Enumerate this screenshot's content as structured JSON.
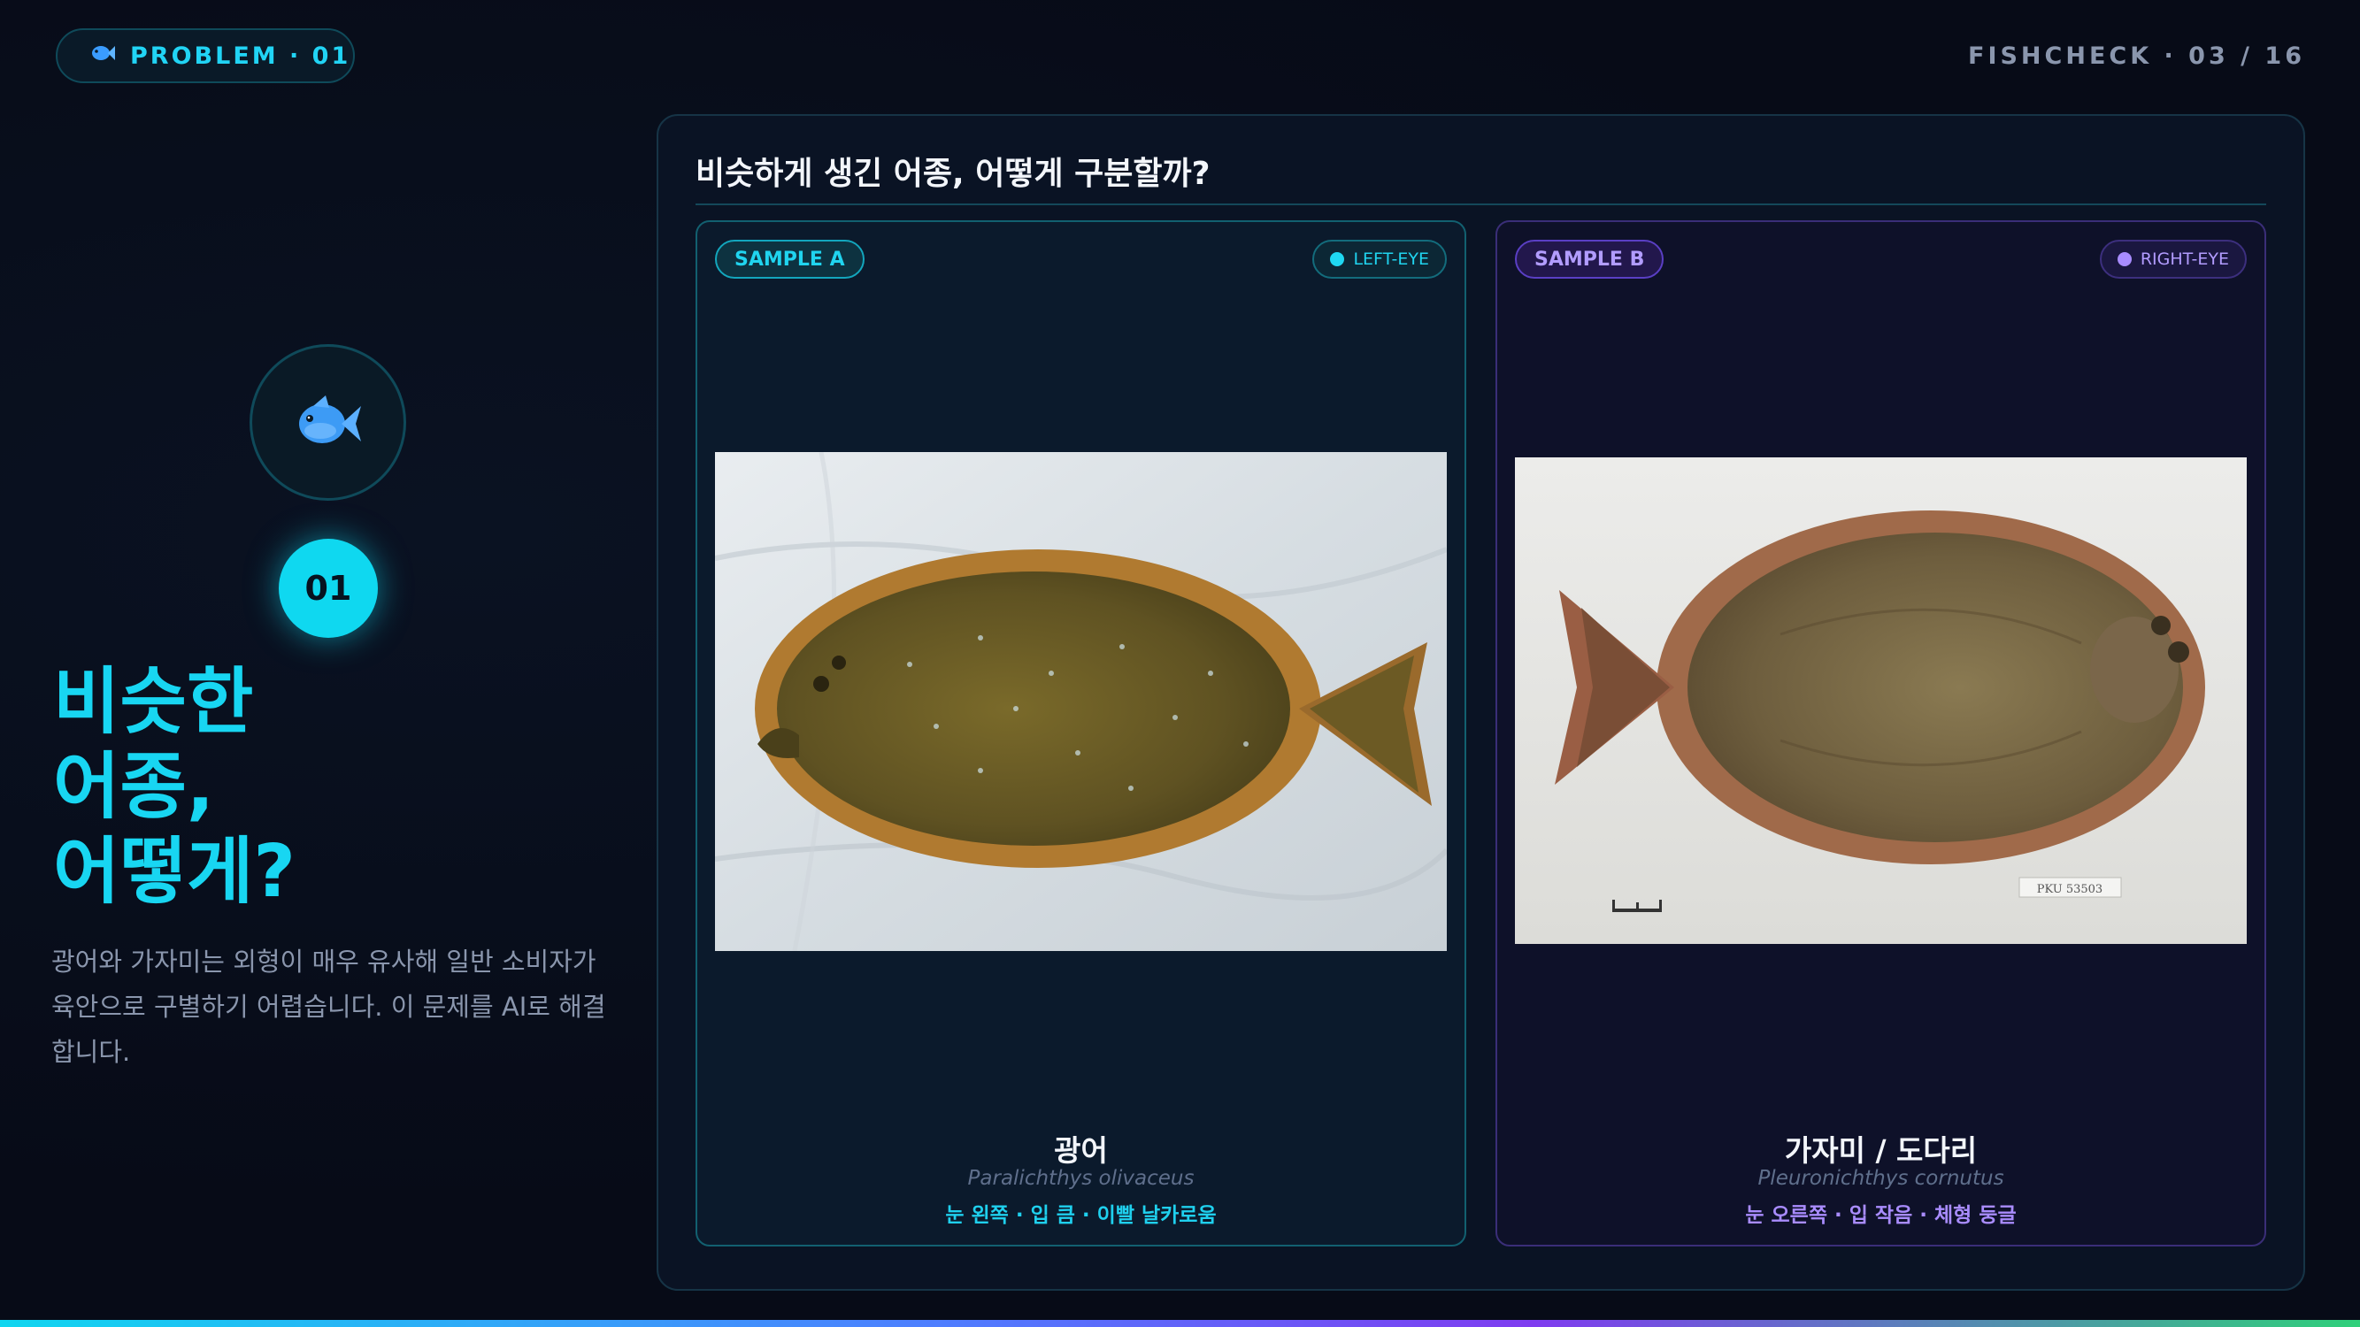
{
  "header": {
    "problem_label": "PROBLEM · 01",
    "counter": "FISHCHECK · 03 / 16"
  },
  "intro": {
    "number": "01",
    "headline_lines": [
      "비슷한",
      "어종,",
      "어떻게?"
    ],
    "description": "광어와 가자미는 외형이 매우 유사해 일반 소비자가 육안으로 구별하기 어렵습니다. 이 문제를 AI로 해결합니다."
  },
  "panel": {
    "title": "비슷하게 생긴 어종, 어떻게 구분할까?",
    "samples": [
      {
        "badge": "SAMPLE A",
        "eye_label": "LEFT-EYE",
        "name": "광어",
        "scientific_name": "Paralichthys olivaceus",
        "traits": "눈 왼쪽 · 입 큼 · 이빨 날카로움"
      },
      {
        "badge": "SAMPLE B",
        "eye_label": "RIGHT-EYE",
        "name": "가자미 / 도다리",
        "scientific_name": "Pleuronichthys cornutus",
        "traits": "눈 오른쪽 · 입 작음 · 체형 둥글",
        "specimen_tag": "PKU 53503"
      }
    ]
  },
  "colors": {
    "accent_cyan": "#18d6f2",
    "accent_purple": "#a98cff",
    "background": "#070b17"
  },
  "icons": {
    "fish": "fish-icon"
  }
}
